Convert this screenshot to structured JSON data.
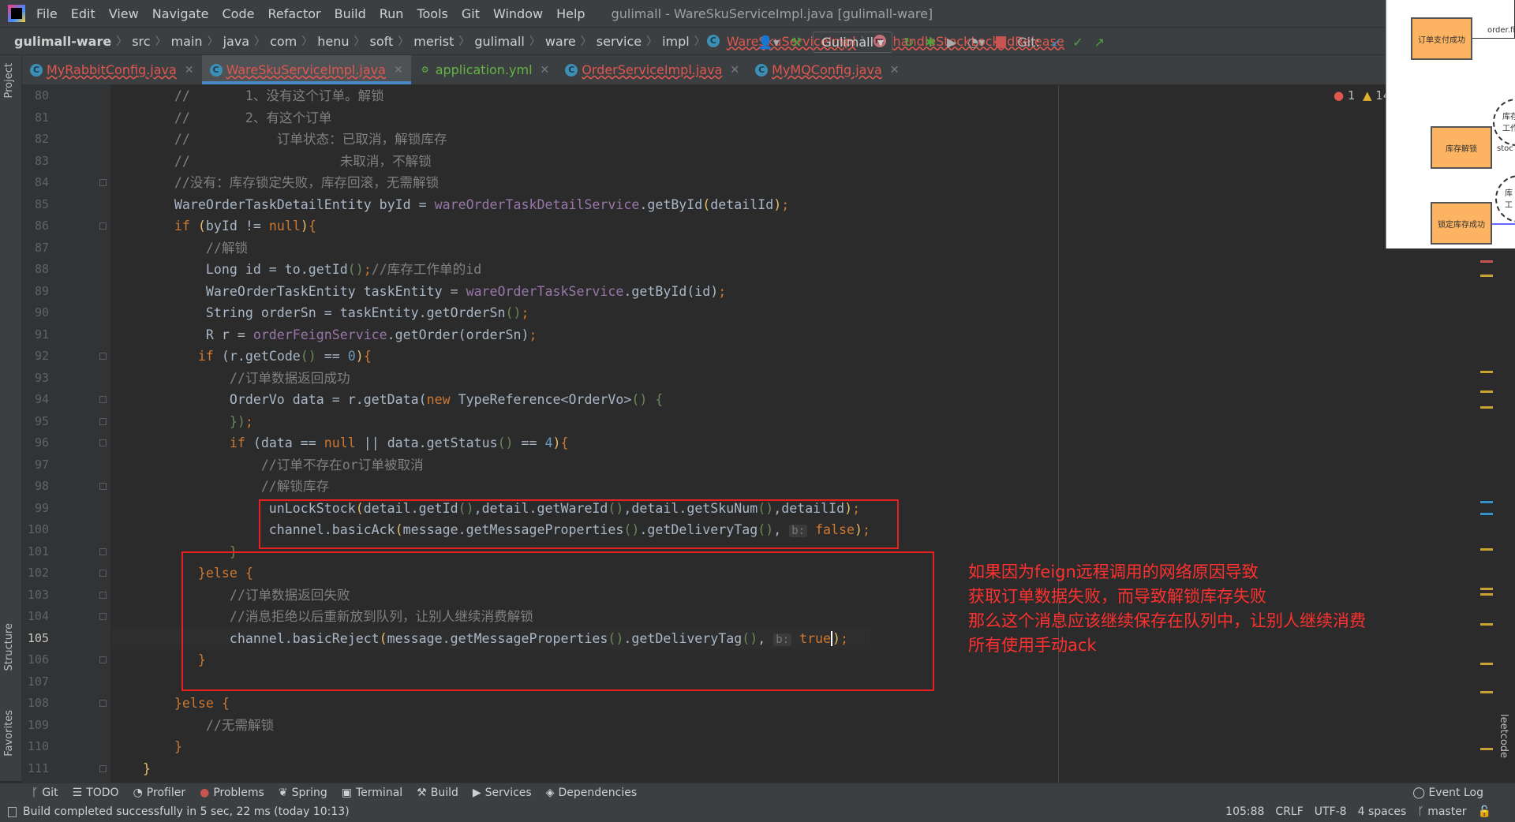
{
  "window": {
    "title": "gulimall - WareSkuServiceImpl.java [gulimall-ware]"
  },
  "menu": [
    "File",
    "Edit",
    "View",
    "Navigate",
    "Code",
    "Refactor",
    "Build",
    "Run",
    "Tools",
    "Git",
    "Window",
    "Help"
  ],
  "breadcrumb": [
    "gulimall-ware",
    "src",
    "main",
    "java",
    "com",
    "henu",
    "soft",
    "merist",
    "gulimall",
    "ware",
    "service",
    "impl"
  ],
  "breadcrumb_class": "WareSkuServiceImpl",
  "breadcrumb_method": "handleStockLockedRelease",
  "toolbar": {
    "run_config": "Gulimall",
    "git_label": "Git:"
  },
  "tabs": [
    {
      "label": "MyRabbitConfig.java",
      "type": "class"
    },
    {
      "label": "WareSkuServiceImpl.java",
      "type": "class",
      "active": true
    },
    {
      "label": "application.yml",
      "type": "yml"
    },
    {
      "label": "OrderServiceImpl.java",
      "type": "class"
    },
    {
      "label": "MyMQConfig.java",
      "type": "class"
    }
  ],
  "side_labels": {
    "project": "Project",
    "structure": "Structure",
    "favorites": "Favorites",
    "leetcode": "leetcode"
  },
  "inspections": {
    "errors": "1",
    "warnings": "14"
  },
  "code": {
    "first_line": 80,
    "current_line": 105,
    "lines": [
      [
        [
          "        //       1、没有这个订单。解锁",
          "c"
        ]
      ],
      [
        [
          "        //       2、有这个订单",
          "c"
        ]
      ],
      [
        [
          "        //           订单状态：已取消，解锁库存",
          "c"
        ]
      ],
      [
        [
          "        //                   未取消，不解锁",
          "c"
        ]
      ],
      [
        [
          "        //没有：库存锁定失败，库存回滚，无需解锁",
          "c"
        ]
      ],
      [
        [
          "        WareOrderTaskDetailEntity byId = ",
          ""
        ],
        [
          "wareOrderTaskDetailService",
          "f"
        ],
        [
          ".getById",
          "",
          ""
        ],
        [
          "(",
          "y"
        ],
        [
          "detailId",
          ""
        ],
        [
          ")",
          "y"
        ],
        [
          ";",
          "k"
        ]
      ],
      [
        [
          "        ",
          ""
        ],
        [
          "if ",
          "k"
        ],
        [
          "(",
          "y"
        ],
        [
          "byId != ",
          ""
        ],
        [
          "null",
          "k"
        ],
        [
          ")",
          "y"
        ],
        [
          "{",
          "k"
        ]
      ],
      [
        [
          "            //解锁",
          "c"
        ]
      ],
      [
        [
          "            Long id = to.getId",
          ""
        ],
        [
          "()",
          "g"
        ],
        [
          ";",
          "k"
        ],
        [
          "//库存工作单的id",
          "c"
        ]
      ],
      [
        [
          "            WareOrderTaskEntity taskEntity = ",
          ""
        ],
        [
          "wareOrderTaskService",
          "f"
        ],
        [
          ".getById(id)",
          ""
        ],
        [
          ";",
          "k"
        ]
      ],
      [
        [
          "            String orderSn = taskEntity.getOrderSn",
          ""
        ],
        [
          "()",
          "g"
        ],
        [
          ";",
          "k"
        ]
      ],
      [
        [
          "            R r = ",
          ""
        ],
        [
          "orderFeignService",
          "f"
        ],
        [
          ".getOrder(orderSn)",
          ""
        ],
        [
          ";",
          "k"
        ]
      ],
      [
        [
          "           ",
          ""
        ],
        [
          "if ",
          "k"
        ],
        [
          "(r.getCode",
          ""
        ],
        [
          "()",
          "g"
        ],
        [
          " == ",
          ""
        ],
        [
          "0",
          "n"
        ],
        [
          ")",
          "y"
        ],
        [
          "{",
          "k"
        ]
      ],
      [
        [
          "               //订单数据返回成功",
          "c"
        ]
      ],
      [
        [
          "               OrderVo data = r.getData(",
          ""
        ],
        [
          "new ",
          "k"
        ],
        [
          "TypeReference<OrderVo>",
          ""
        ],
        [
          "() {",
          "g"
        ]
      ],
      [
        [
          "               ",
          ""
        ],
        [
          "})",
          "g"
        ],
        [
          ";",
          "k"
        ]
      ],
      [
        [
          "               ",
          ""
        ],
        [
          "if ",
          "k"
        ],
        [
          "(data == ",
          ""
        ],
        [
          "null",
          "k"
        ],
        [
          " || data.getStatus",
          ""
        ],
        [
          "()",
          "g"
        ],
        [
          " == ",
          ""
        ],
        [
          "4",
          "n"
        ],
        [
          ")",
          "y"
        ],
        [
          "{",
          "k"
        ]
      ],
      [
        [
          "                   //订单不存在or订单被取消",
          "c"
        ]
      ],
      [
        [
          "                   //解锁库存",
          "c"
        ]
      ],
      [
        [
          "                    unLockStock",
          ""
        ],
        [
          "(",
          "y"
        ],
        [
          "detail.getId",
          ""
        ],
        [
          "()",
          "g"
        ],
        [
          ",detail.getWareId",
          ""
        ],
        [
          "()",
          "g"
        ],
        [
          ",detail.getSkuNum",
          ""
        ],
        [
          "()",
          "g"
        ],
        [
          ",detailId",
          ""
        ],
        [
          ")",
          "y"
        ],
        [
          ";",
          "k"
        ]
      ],
      [
        [
          "                    channel.basicAck",
          ""
        ],
        [
          "(",
          "y"
        ],
        [
          "message.getMessageProperties",
          ""
        ],
        [
          "()",
          "g"
        ],
        [
          ".getDeliveryTag",
          ""
        ],
        [
          "()",
          "g"
        ],
        [
          ", ",
          ""
        ],
        [
          "b:",
          "hint"
        ],
        [
          " ",
          ""
        ],
        [
          "false",
          "k"
        ],
        [
          ")",
          "y"
        ],
        [
          ";",
          "k"
        ]
      ],
      [
        [
          "               ",
          ""
        ],
        [
          "}",
          "g"
        ]
      ],
      [
        [
          "           ",
          ""
        ],
        [
          "}else ",
          "k"
        ],
        [
          "{",
          "k"
        ]
      ],
      [
        [
          "               //订单数据返回失败",
          "c"
        ]
      ],
      [
        [
          "               //消息拒绝以后重新放到队列，让别人继续消费解锁",
          "c"
        ]
      ],
      [
        [
          "               channel.basicReject",
          ""
        ],
        [
          "(",
          "y"
        ],
        [
          "message.getMessageProperties",
          ""
        ],
        [
          "()",
          "g"
        ],
        [
          ".getDeliveryTag",
          ""
        ],
        [
          "()",
          "g"
        ],
        [
          ", ",
          ""
        ],
        [
          "b:",
          "hint"
        ],
        [
          " ",
          ""
        ],
        [
          "true",
          "k"
        ],
        [
          ")",
          "y caret"
        ],
        [
          ";",
          "k"
        ]
      ],
      [
        [
          "           ",
          ""
        ],
        [
          "}",
          "k"
        ]
      ],
      [
        [
          "",
          ""
        ]
      ],
      [
        [
          "        ",
          ""
        ],
        [
          "}else ",
          "k"
        ],
        [
          "{",
          "k"
        ]
      ],
      [
        [
          "            //无需解锁",
          "c"
        ]
      ],
      [
        [
          "        ",
          ""
        ],
        [
          "}",
          "k"
        ]
      ],
      [
        [
          "    ",
          ""
        ],
        [
          "}",
          "y"
        ]
      ]
    ]
  },
  "annotation": [
    "如果因为feign远程调用的网络原因导致",
    "获取订单数据失败，而导致解锁库存失败",
    "那么这个消息应该继续保存在队列中，让别人继续消费",
    "所有使用手动ack"
  ],
  "overlay_diagram": {
    "boxes": [
      "订单支付成功",
      "库存解锁",
      "锁定库存成功"
    ],
    "labels": [
      "order.fi",
      "stoc"
    ],
    "circles": [
      "库存\n工作",
      "库\n工"
    ]
  },
  "bottom_tools": [
    "Git",
    "TODO",
    "Profiler",
    "Problems",
    "Spring",
    "Terminal",
    "Build",
    "Services",
    "Dependencies"
  ],
  "event_log": "Event Log",
  "status": {
    "message": "Build completed successfully in 5 sec, 22 ms (today 10:13)",
    "position": "105:88",
    "line_sep": "CRLF",
    "encoding": "UTF-8",
    "indent": "4 spaces",
    "branch": "master"
  },
  "colors": {
    "annotation": "#ff3030",
    "highlight_box": "#e82020",
    "keyword": "#cc7832",
    "comment": "#808080",
    "field": "#9876aa"
  }
}
